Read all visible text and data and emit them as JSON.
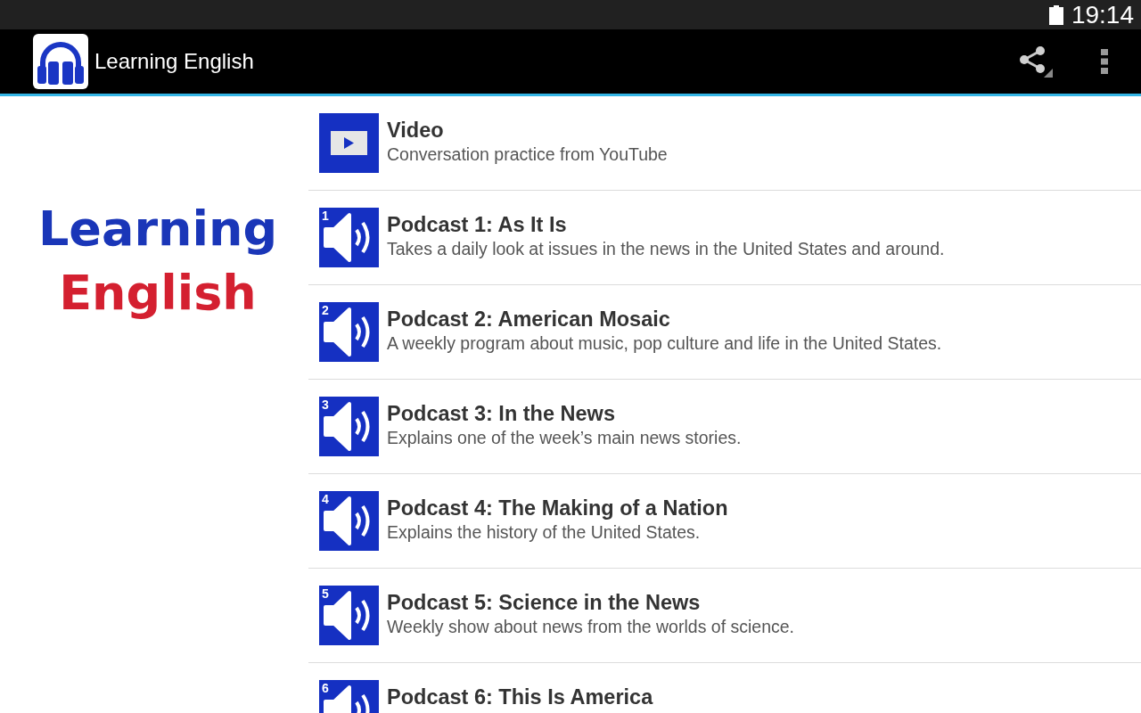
{
  "status_bar": {
    "time": "19:14"
  },
  "action_bar": {
    "title": "Learning English"
  },
  "logo": {
    "lines": [
      {
        "text": "Learning",
        "color": "#1a36b8"
      },
      {
        "text": "English",
        "color": "#d42030"
      }
    ]
  },
  "items": [
    {
      "kind": "video",
      "title": "Video",
      "subtitle": "Conversation practice from YouTube"
    },
    {
      "kind": "podcast",
      "number": "1",
      "title": "Podcast 1: As It Is",
      "subtitle": "Takes a daily look at issues in the news in the United States and around."
    },
    {
      "kind": "podcast",
      "number": "2",
      "title": "Podcast 2: American Mosaic",
      "subtitle": "A weekly program about music, pop culture and life in the United States."
    },
    {
      "kind": "podcast",
      "number": "3",
      "title": "Podcast 3: In the News",
      "subtitle": "Explains one of the week’s main news stories."
    },
    {
      "kind": "podcast",
      "number": "4",
      "title": "Podcast 4: The Making of a Nation",
      "subtitle": "Explains the history of the United States."
    },
    {
      "kind": "podcast",
      "number": "5",
      "title": "Podcast 5: Science in the News",
      "subtitle": "Weekly show about news from the worlds of science."
    },
    {
      "kind": "podcast",
      "number": "6",
      "title": "Podcast 6: This Is America"
    }
  ]
}
